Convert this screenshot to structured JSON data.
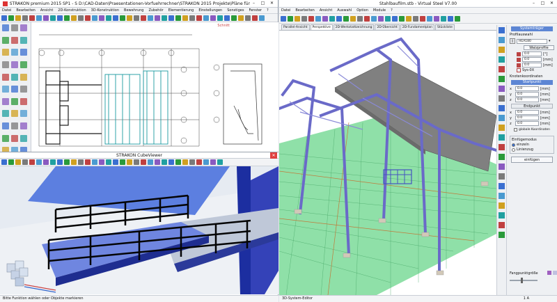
{
  "strakon": {
    "title": "STRAKON premium 2015 SP1  -  S  D:\\CAD-Daten\\Praesentationen-Vorfuehrrechner\\STRAKON 2015 Projekte\\Pläne für Fil...",
    "menu": [
      "Datei",
      "Bearbeiten",
      "Ansicht",
      "2D-Konstruktion",
      "3D-Konstruktion",
      "Bewehrung",
      "Zubehör",
      "Elementierung",
      "Einstellungen",
      "Sonstiges",
      "Fenster",
      "?"
    ],
    "drawing_tab": "Schnitt",
    "cubeviewer_title": "STRAKON CubeViewer",
    "status": "Bitte Funktion wählen oder Objekte markieren"
  },
  "vsteel": {
    "title": "Stahlbaufilm.stb  -  Virtual Steel V7.00",
    "menu": [
      "Datei",
      "Bearbeiten",
      "Ansicht",
      "Auswahl",
      "Option",
      "Module",
      "?"
    ],
    "tabs": [
      "Parallel-Ansicht",
      "Perspektive",
      "2D-Werkstattzeichnung",
      "2D-Übersicht",
      "2D-Fundamentplan",
      "Stückliste"
    ],
    "active_tab": 1,
    "panel": {
      "header": "Systemträger",
      "profile_label": "Profilauswahl",
      "profile_value": "HEA180",
      "profile_button": "Walzprofile",
      "angle_value": "0.0",
      "angle_unit": "[°]",
      "offset1": "0.0",
      "offset2": "0.0",
      "offset_unit": "[mm]",
      "sys_label": "Sys-0X",
      "coords_label": "Knotenkoordinaten",
      "start_header": "Startpunkt",
      "end_header": "Endpunkt",
      "axes": [
        "x",
        "y",
        "z"
      ],
      "coord_value": "0.0",
      "coord_unit": "[mm]",
      "global_label": "globale Koordinaten",
      "insert_label": "Einfügemodus",
      "mode1": "einzeln",
      "mode2": "Linienzug",
      "insert_button": "einfügen",
      "snap_label": "Fangpunktgröße"
    },
    "status_left": "3D-System-Editor",
    "status_right": "1 A"
  }
}
